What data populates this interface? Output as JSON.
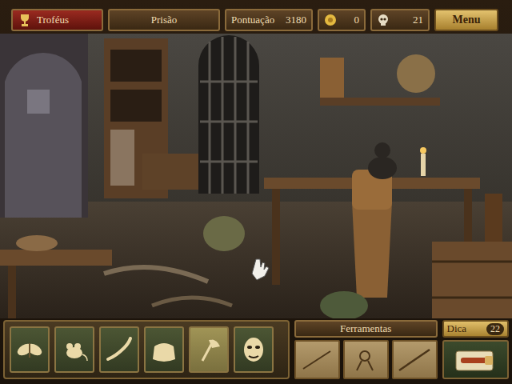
{
  "top_bar": {
    "trophies": "Troféus",
    "location": "Prisão",
    "score_label": "Pontuação",
    "score": "3180",
    "coins": "0",
    "skulls": "21",
    "menu": "Menu"
  },
  "items_to_find": [
    {
      "highlighted": false
    },
    {
      "highlighted": false
    },
    {
      "highlighted": false
    },
    {
      "highlighted": false
    },
    {
      "highlighted": true
    },
    {
      "highlighted": false
    }
  ],
  "tools": {
    "label": "Ferramentas"
  },
  "hint": {
    "label": "Dica",
    "count": "22"
  }
}
